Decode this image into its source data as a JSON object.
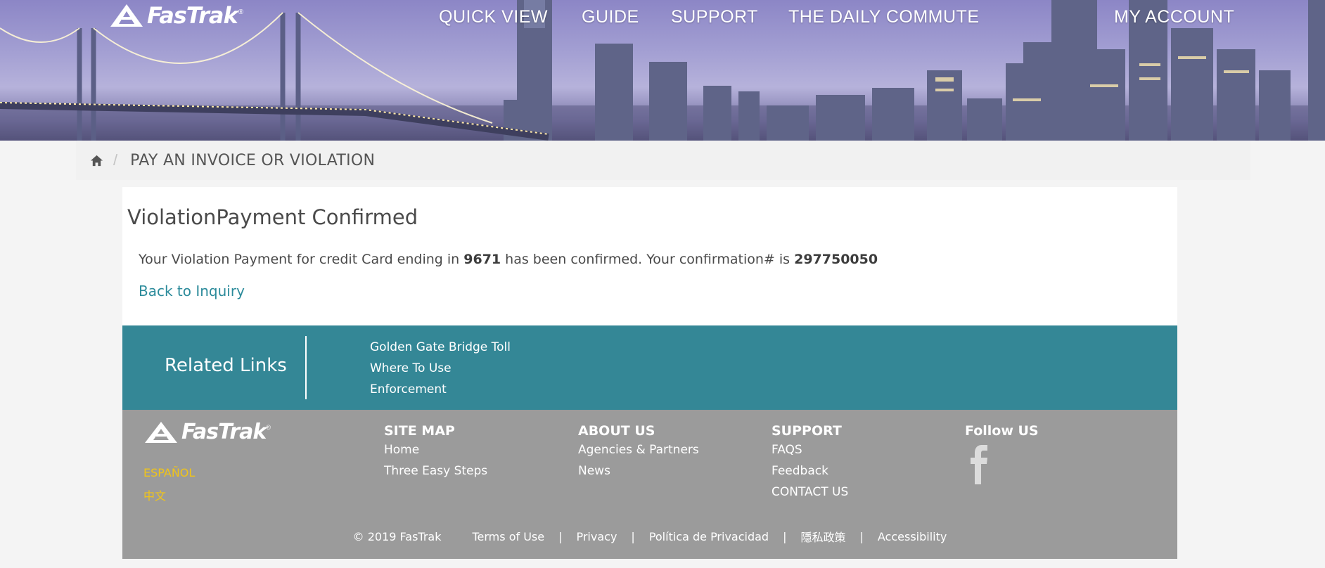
{
  "brand": {
    "name": "FasTrak",
    "registered": "®"
  },
  "nav": {
    "quick_view": "QUICK VIEW",
    "guide": "GUIDE",
    "support": "SUPPORT",
    "daily_commute": "THE DAILY COMMUTE",
    "my_account": "MY ACCOUNT"
  },
  "breadcrumb": {
    "separator": "/",
    "current": "PAY AN INVOICE OR VIOLATION"
  },
  "main": {
    "heading": "ViolationPayment Confirmed",
    "msg_part1": "Your Violation Payment for credit Card ending in ",
    "card_last4": "9671",
    "msg_part2": " has been confirmed. Your confirmation# is ",
    "confirmation_number": "297750050",
    "back_link": "Back to Inquiry"
  },
  "related": {
    "title": "Related Links",
    "links": [
      "Golden Gate Bridge Toll",
      "Where To Use",
      "Enforcement"
    ]
  },
  "footer": {
    "languages": [
      "ESPAÑOL",
      "中文"
    ],
    "site_map": {
      "heading": "SITE MAP",
      "links": [
        "Home",
        "Three Easy Steps"
      ]
    },
    "about_us": {
      "heading": "ABOUT US",
      "links": [
        "Agencies & Partners",
        "News"
      ]
    },
    "support": {
      "heading": "SUPPORT",
      "links": [
        "FAQS",
        "Feedback",
        "CONTACT US"
      ]
    },
    "follow": {
      "heading": "Follow US",
      "icon": "facebook-icon"
    },
    "legal": {
      "copyright": "© 2019 FasTrak",
      "links": [
        "Terms of Use",
        "Privacy",
        "Política de Privacidad",
        "隱私政策",
        "Accessibility"
      ],
      "separator": "|"
    }
  },
  "colors": {
    "teal": "#348796",
    "footer_gray": "#9b9b9b",
    "link_teal": "#2c8b9b",
    "language_yellow": "#f0c419"
  }
}
